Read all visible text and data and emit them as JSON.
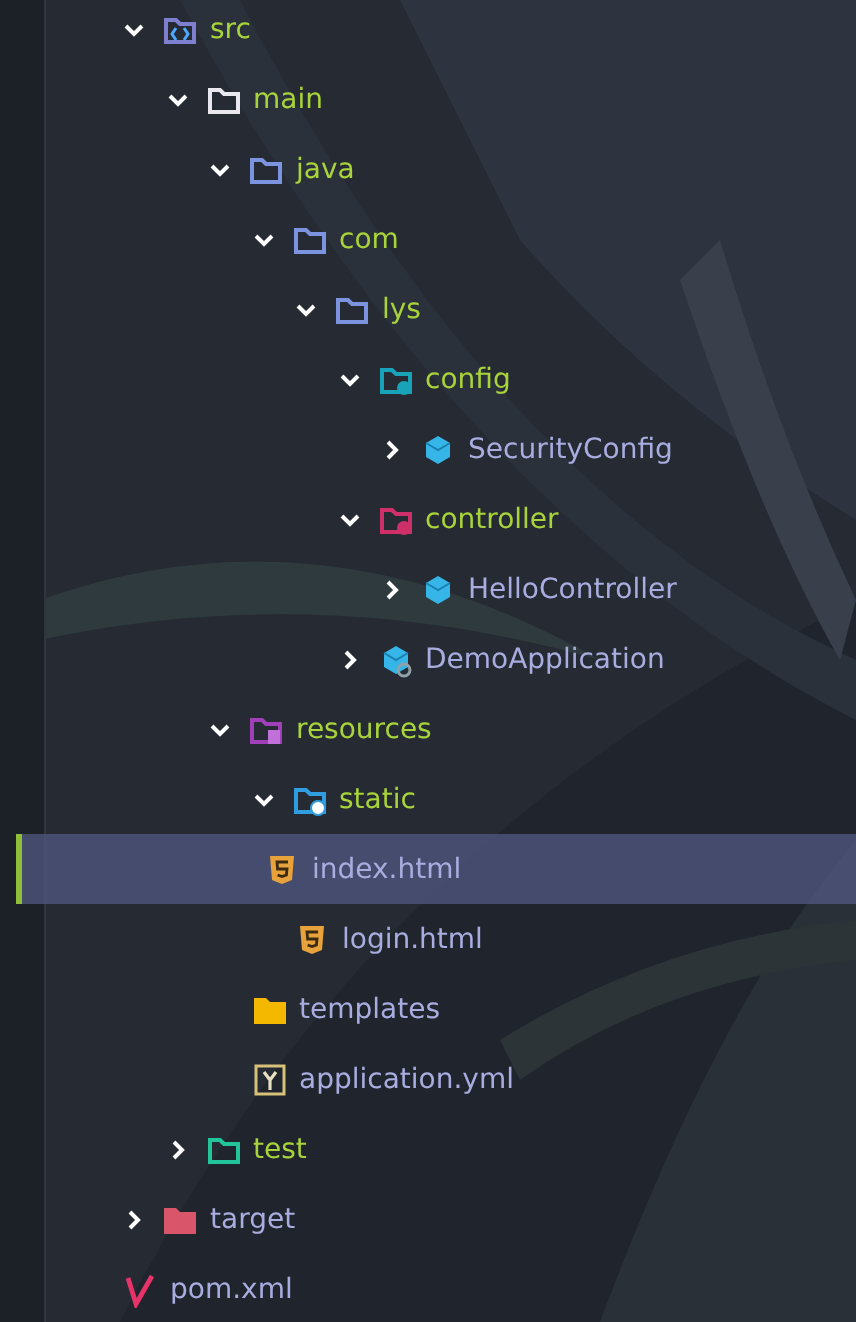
{
  "tree": [
    {
      "label": "src",
      "kind": "source-folder",
      "color": "#a8d33a",
      "expanded": true,
      "selected": false,
      "children": [
        {
          "label": "main",
          "kind": "folder",
          "color": "#a8d33a",
          "expanded": true,
          "selected": false,
          "children": [
            {
              "label": "java",
              "kind": "package-folder",
              "color": "#a8d33a",
              "expanded": true,
              "selected": false,
              "children": [
                {
                  "label": "com",
                  "kind": "package-folder",
                  "color": "#a8d33a",
                  "expanded": true,
                  "selected": false,
                  "children": [
                    {
                      "label": "lys",
                      "kind": "package-folder",
                      "color": "#a8d33a",
                      "expanded": true,
                      "selected": false,
                      "children": [
                        {
                          "label": "config",
                          "kind": "config-folder",
                          "color": "#a8d33a",
                          "expanded": true,
                          "selected": false,
                          "children": [
                            {
                              "label": "SecurityConfig",
                              "kind": "class",
                              "color": "#a9acdf",
                              "expanded": false,
                              "selected": false
                            }
                          ]
                        },
                        {
                          "label": "controller",
                          "kind": "controller-folder",
                          "color": "#a8d33a",
                          "expanded": true,
                          "selected": false,
                          "children": [
                            {
                              "label": "HelloController",
                              "kind": "class",
                              "color": "#a9acdf",
                              "expanded": false,
                              "selected": false
                            }
                          ]
                        },
                        {
                          "label": "DemoApplication",
                          "kind": "app-class",
                          "color": "#a9acdf",
                          "expanded": false,
                          "selected": false
                        }
                      ]
                    }
                  ]
                }
              ]
            },
            {
              "label": "resources",
              "kind": "resources-folder",
              "color": "#a8d33a",
              "expanded": true,
              "selected": false,
              "children": [
                {
                  "label": "static",
                  "kind": "web-folder",
                  "color": "#a8d33a",
                  "expanded": true,
                  "selected": false,
                  "children": [
                    {
                      "label": "index.html",
                      "kind": "html",
                      "color": "#a9acdf",
                      "selected": true
                    },
                    {
                      "label": "login.html",
                      "kind": "html",
                      "color": "#a9acdf",
                      "selected": false
                    }
                  ]
                },
                {
                  "label": "templates",
                  "kind": "templates-folder",
                  "color": "#a9acdf",
                  "selected": false
                },
                {
                  "label": "application.yml",
                  "kind": "yaml",
                  "color": "#a9acdf",
                  "selected": false
                }
              ]
            }
          ]
        },
        {
          "label": "test",
          "kind": "test-folder",
          "color": "#a8d33a",
          "expanded": false,
          "selected": false
        }
      ]
    },
    {
      "label": "target",
      "kind": "target-folder",
      "color": "#a9acdf",
      "expanded": false,
      "selected": false
    },
    {
      "label": "pom.xml",
      "kind": "maven",
      "color": "#a9acdf",
      "selected": false
    }
  ]
}
